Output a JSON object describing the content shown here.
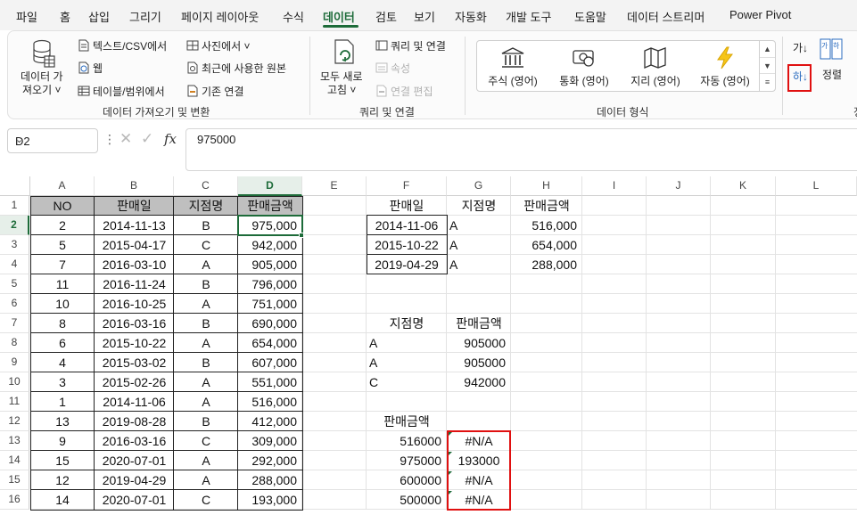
{
  "menu": {
    "tabs": [
      "파일",
      "홈",
      "삽입",
      "그리기",
      "페이지 레이아웃",
      "수식",
      "데이터",
      "검토",
      "보기",
      "자동화",
      "개발 도구",
      "도움말",
      "데이터 스트리머",
      "Power Pivot"
    ],
    "active_tab": "데이터"
  },
  "ribbon": {
    "get_data": {
      "line1": "데이터 가",
      "line2": "져오기 ˅"
    },
    "from_text_csv": "텍스트/CSV에서",
    "from_web": "웹",
    "from_table_range": "테이블/범위에서",
    "from_picture": "사진에서 ˅",
    "recent_sources": "최근에 사용한 원본",
    "existing_connections": "기존 연결",
    "group_get_transform": "데이터 가져오기 및 변환",
    "refresh_all": {
      "line1": "모두 새로",
      "line2": "고침 ˅"
    },
    "queries_connections": "쿼리 및 연결",
    "properties": "속성",
    "edit_links": "연결 편집",
    "group_queries": "쿼리 및 연결",
    "data_types": [
      {
        "label": "주식 (영어)",
        "icon": "bank-icon"
      },
      {
        "label": "통화 (영어)",
        "icon": "currency-icon"
      },
      {
        "label": "지리 (영어)",
        "icon": "map-icon"
      },
      {
        "label": "자동 (영어)",
        "icon": "lightning-icon"
      }
    ],
    "group_data_types": "데이터 형식",
    "sort_asc_label": "가↓",
    "sort_desc_label": "하↓",
    "sort": "정렬",
    "sort_icon_label": "가하",
    "group_sort_partial": "정"
  },
  "formula_bar": {
    "name_box": "D2",
    "fx": "fx",
    "formula": "975000"
  },
  "grid": {
    "columns": [
      "A",
      "B",
      "C",
      "D",
      "E",
      "F",
      "G",
      "H",
      "I",
      "J",
      "K",
      "L"
    ],
    "rows": [
      "1",
      "2",
      "3",
      "4",
      "5",
      "6",
      "7",
      "8",
      "9",
      "10",
      "11",
      "12",
      "13",
      "14",
      "15",
      "16"
    ],
    "table1": {
      "headers": [
        "NO",
        "판매일",
        "지점명",
        "판매금액"
      ],
      "rows": [
        [
          "2",
          "2014-11-13",
          "B",
          "975,000"
        ],
        [
          "5",
          "2015-04-17",
          "C",
          "942,000"
        ],
        [
          "7",
          "2016-03-10",
          "A",
          "905,000"
        ],
        [
          "11",
          "2016-11-24",
          "B",
          "796,000"
        ],
        [
          "10",
          "2016-10-25",
          "A",
          "751,000"
        ],
        [
          "8",
          "2016-03-16",
          "B",
          "690,000"
        ],
        [
          "6",
          "2015-10-22",
          "A",
          "654,000"
        ],
        [
          "4",
          "2015-03-02",
          "B",
          "607,000"
        ],
        [
          "3",
          "2015-02-26",
          "A",
          "551,000"
        ],
        [
          "1",
          "2014-11-06",
          "A",
          "516,000"
        ],
        [
          "13",
          "2019-08-28",
          "B",
          "412,000"
        ],
        [
          "9",
          "2016-03-16",
          "C",
          "309,000"
        ],
        [
          "15",
          "2020-07-01",
          "A",
          "292,000"
        ],
        [
          "12",
          "2019-04-29",
          "A",
          "288,000"
        ],
        [
          "14",
          "2020-07-01",
          "C",
          "193,000"
        ]
      ]
    },
    "table2": {
      "headers": [
        "판매일",
        "지점명",
        "판매금액"
      ],
      "rows": [
        [
          "2014-11-06",
          "A",
          "516,000"
        ],
        [
          "2015-10-22",
          "A",
          "654,000"
        ],
        [
          "2019-04-29",
          "A",
          "288,000"
        ]
      ]
    },
    "table3": {
      "headers": [
        "지점명",
        "판매금액"
      ],
      "rows": [
        [
          "A",
          "905000"
        ],
        [
          "A",
          "905000"
        ],
        [
          "C",
          "942000"
        ]
      ]
    },
    "table4": {
      "header": "판매금액",
      "rows": [
        [
          "516000",
          "#N/A"
        ],
        [
          "975000",
          "193000"
        ],
        [
          "600000",
          "#N/A"
        ],
        [
          "500000",
          "#N/A"
        ]
      ]
    }
  },
  "colors": {
    "accent": "#1d6b39",
    "highlight": "#e01010",
    "header_fill": "#bfbfbf"
  }
}
